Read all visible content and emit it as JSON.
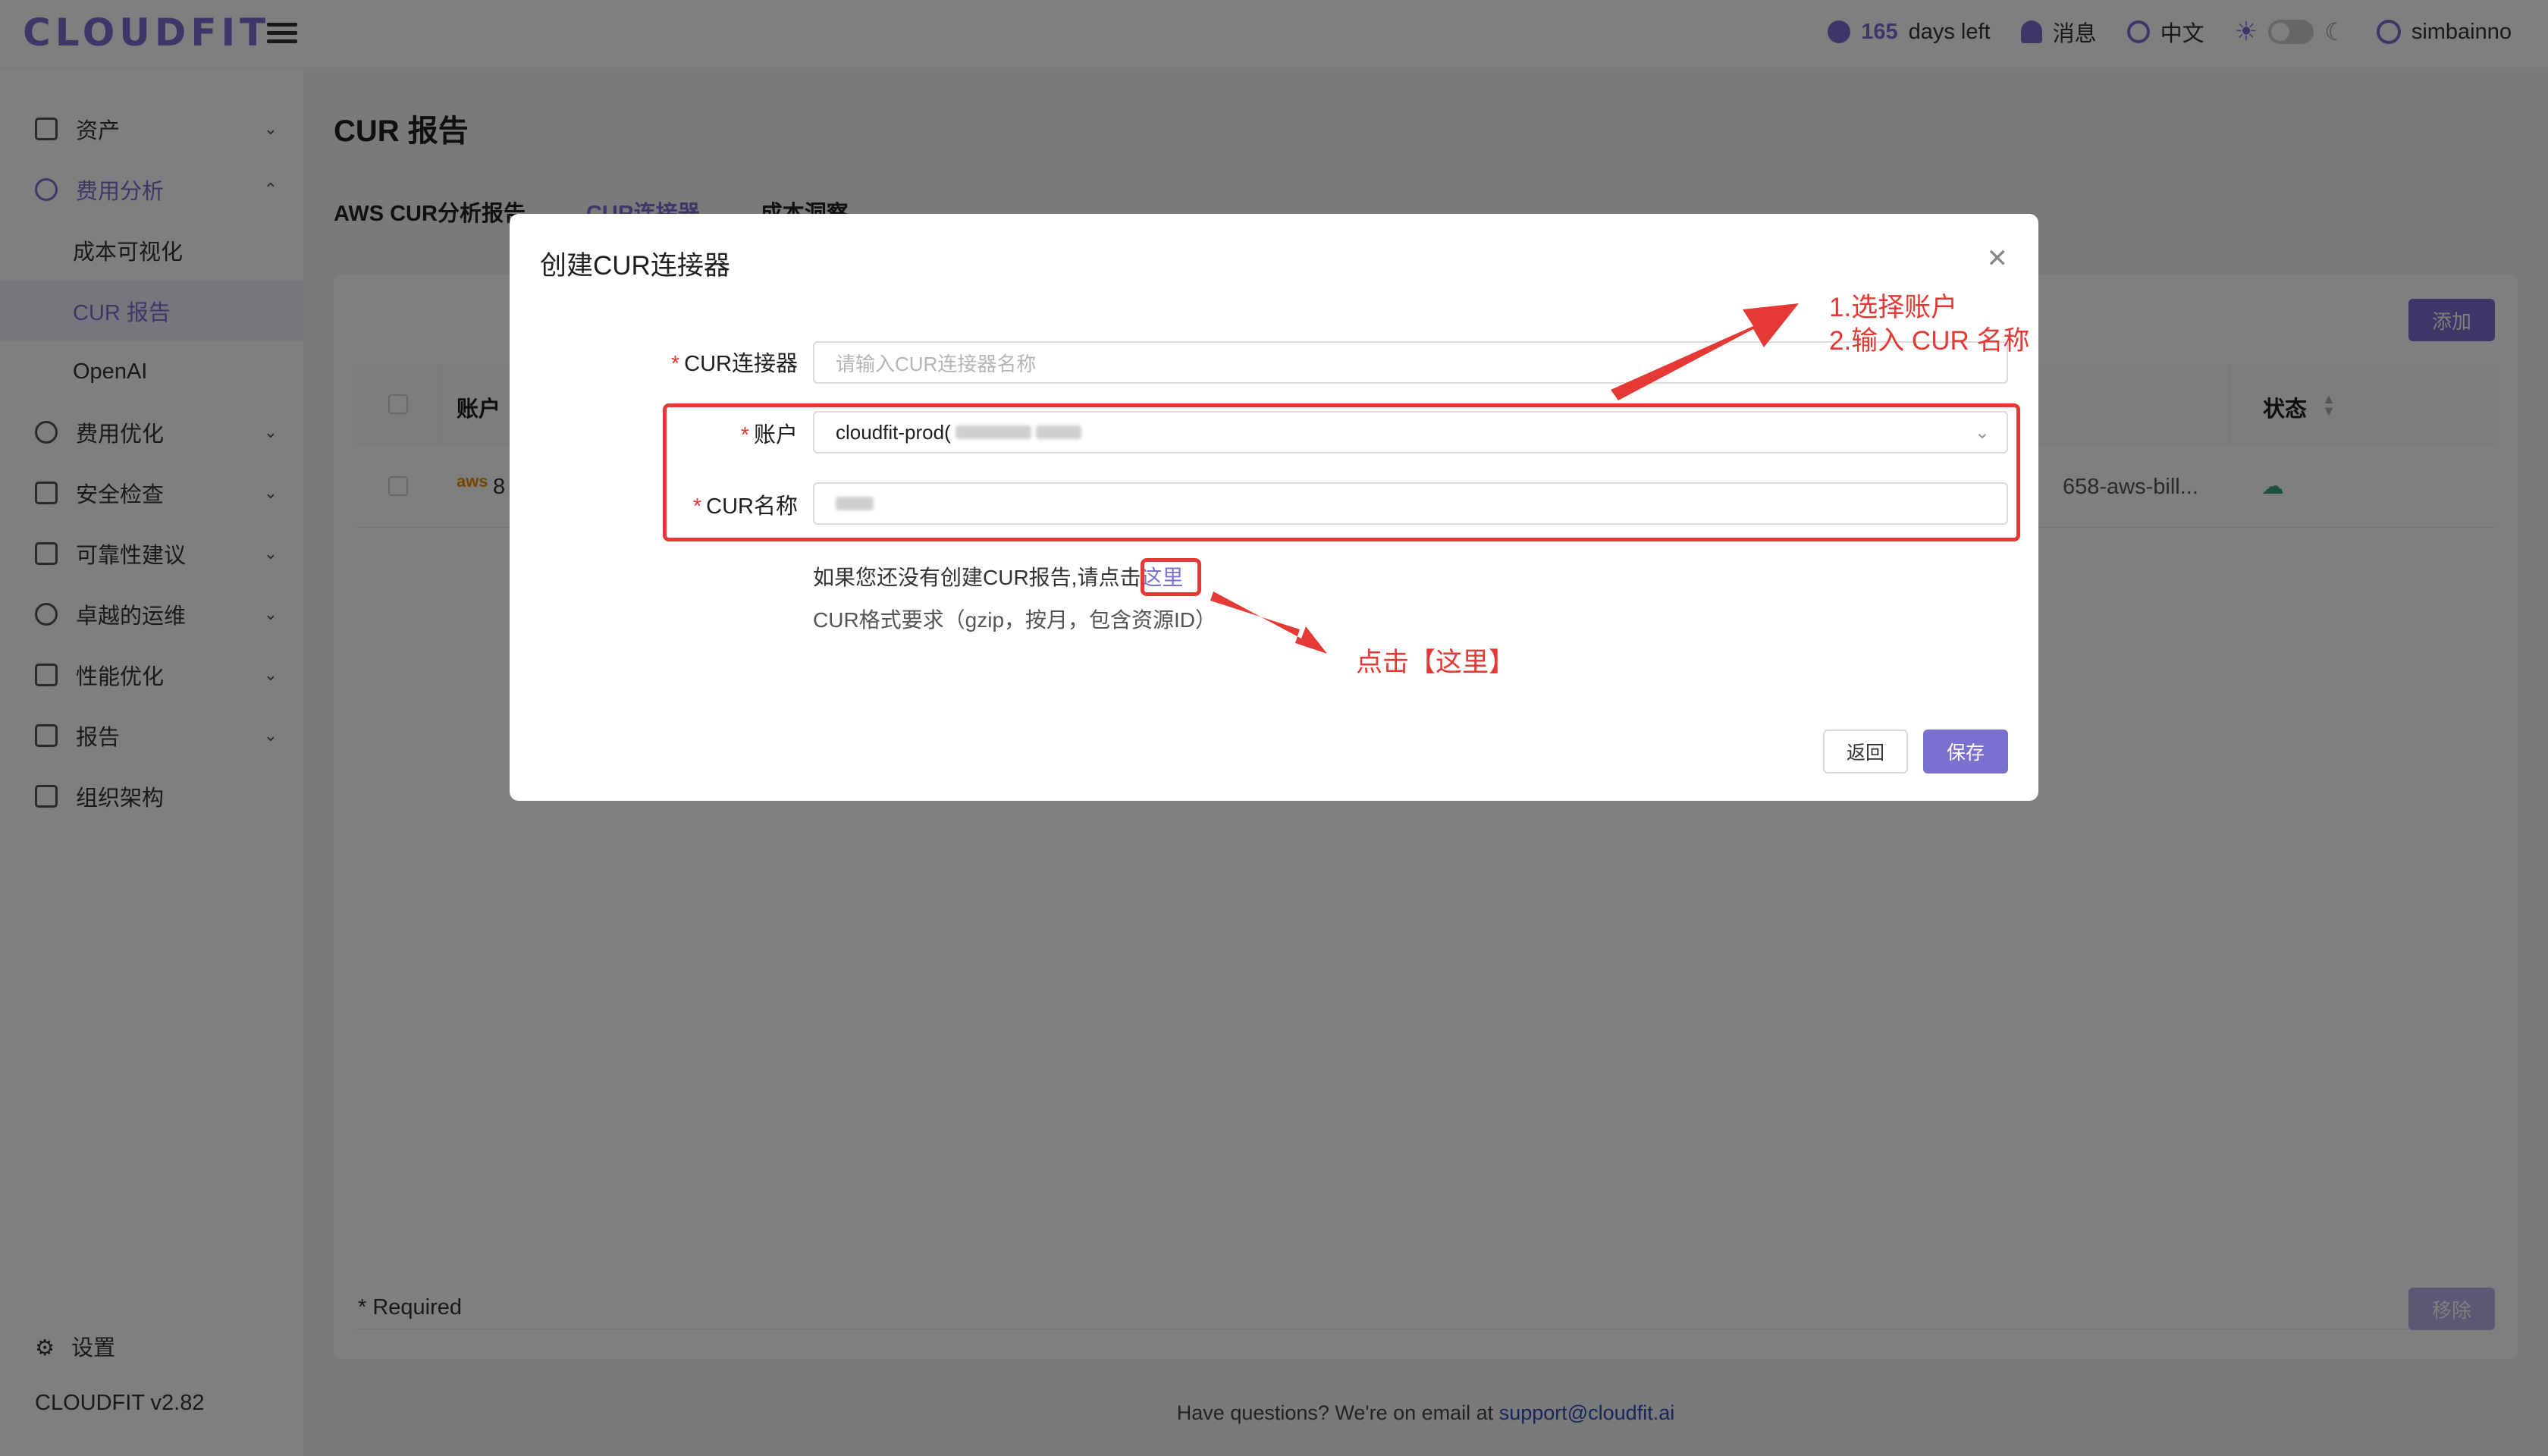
{
  "app": {
    "logo": "CLOUDFIT",
    "days_left_num": "165",
    "days_left_text": "days left",
    "messages": "消息",
    "language": "中文",
    "username": "simbainno"
  },
  "sidebar": {
    "items": [
      {
        "label": "资产"
      },
      {
        "label": "费用分析"
      },
      {
        "label": "费用优化"
      },
      {
        "label": "安全检查"
      },
      {
        "label": "可靠性建议"
      },
      {
        "label": "卓越的运维"
      },
      {
        "label": "性能优化"
      },
      {
        "label": "报告"
      },
      {
        "label": "组织架构"
      }
    ],
    "sub_items": [
      {
        "label": "成本可视化"
      },
      {
        "label": "CUR 报告"
      },
      {
        "label": "OpenAI"
      }
    ],
    "settings": "设置",
    "version": "CLOUDFIT v2.82"
  },
  "main": {
    "title": "CUR 报告",
    "tabs": [
      {
        "label": "AWS CUR分析报告"
      },
      {
        "label": "CUR连接器"
      },
      {
        "label": "成本洞察"
      }
    ],
    "add_button": "添加",
    "table": {
      "col_account": "账户",
      "col_status": "状态",
      "row_account_fragment": "8",
      "row_aws_logo": "aws",
      "row_bill_fragment": "658-aws-bill..."
    },
    "required_note": "* Required",
    "remove_button": "移除",
    "footer_text": "Have questions? We're on email at",
    "footer_email": "support@cloudfit.ai"
  },
  "modal": {
    "title": "创建CUR连接器",
    "field_connector_label": "CUR连接器",
    "field_connector_placeholder": "请输入CUR连接器名称",
    "field_account_label": "账户",
    "field_account_value": "cloudfit-prod(",
    "field_curname_label": "CUR名称",
    "hint_prefix": "如果您还没有创建CUR报告,请点击",
    "hint_link": "这里",
    "hint_format": "CUR格式要求（gzip，按月，包含资源ID）",
    "back_button": "返回",
    "save_button": "保存"
  },
  "annotations": {
    "step1": "1.选择账户",
    "step2": "2.输入 CUR 名称",
    "click_here": "点击【这里】"
  },
  "colors": {
    "accent": "#7b6fd0",
    "annotation_red": "#e53935"
  }
}
